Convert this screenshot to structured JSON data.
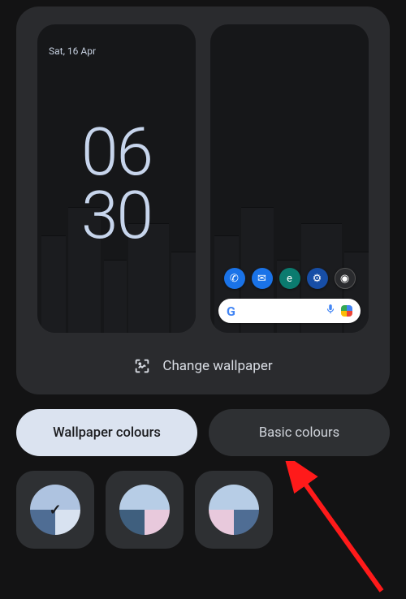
{
  "lock_preview": {
    "date": "Sat, 16 Apr",
    "clock_top": "06",
    "clock_bot": "30"
  },
  "home_preview": {
    "dock": [
      {
        "name": "phone-app-icon",
        "glyph": "✆",
        "css": "ic-phone"
      },
      {
        "name": "messages-app-icon",
        "glyph": "✉",
        "css": "ic-msg"
      },
      {
        "name": "edge-app-icon",
        "glyph": "e",
        "css": "ic-edge"
      },
      {
        "name": "settings-app-icon",
        "glyph": "⚙",
        "css": "ic-set"
      },
      {
        "name": "camera-app-icon",
        "glyph": "◉",
        "css": "ic-cam"
      }
    ]
  },
  "actions": {
    "change_wallpaper": "Change wallpaper"
  },
  "tabs": {
    "wallpaper": "Wallpaper colours",
    "basic": "Basic colours",
    "active": "wallpaper"
  },
  "swatches": [
    {
      "top": "#aec3e0",
      "bl": "#4f6d94",
      "br": "#d8e2f0",
      "selected": true
    },
    {
      "top": "#b7cde6",
      "bl": "#3f5f7e",
      "br": "#e8c9dc",
      "selected": false
    },
    {
      "top": "#b7cde6",
      "bl": "#e8c9dc",
      "br": "#4f6d94",
      "selected": false
    }
  ],
  "annotation": {
    "arrow_color": "#ff1a1a"
  }
}
